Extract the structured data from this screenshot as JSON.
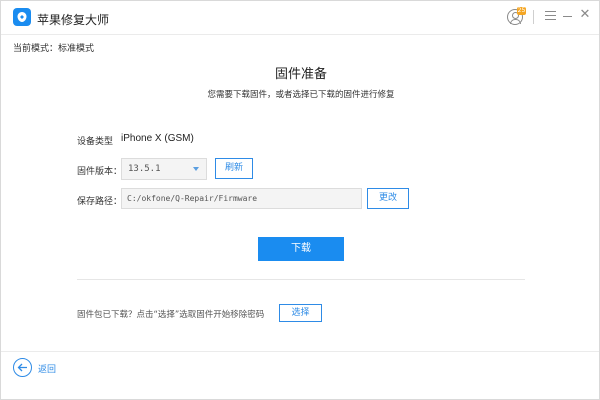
{
  "window": {
    "app_title": "苹果修复大师",
    "badge": "25"
  },
  "mode": {
    "label": "当前模式：标准模式"
  },
  "main": {
    "title": "固件准备",
    "subtitle": "您需要下载固件，或者选择已下载的固件进行修复",
    "device_type_label": "设备类型",
    "device_type_value": "iPhone X (GSM)",
    "firmware_version_label": "固件版本：",
    "firmware_version_value": "13.5.1",
    "refresh_label": "刷新",
    "save_path_label": "保存路径：",
    "save_path_value": "C:/okfone/Q-Repair/Firmware",
    "change_label": "更改",
    "download_label": "下载",
    "hint_text": "固件包已下载？点击“选择”选取固件开始移除密码",
    "select_label": "选择"
  },
  "footer": {
    "back_label": "返回"
  },
  "colors": {
    "accent": "#1a8cf0",
    "outline": "#2e8be6"
  },
  "icons": [
    "app-logo-icon",
    "user-icon",
    "menu-icon",
    "minimize-icon",
    "close-icon",
    "dropdown-arrow-icon",
    "back-arrow-icon"
  ]
}
